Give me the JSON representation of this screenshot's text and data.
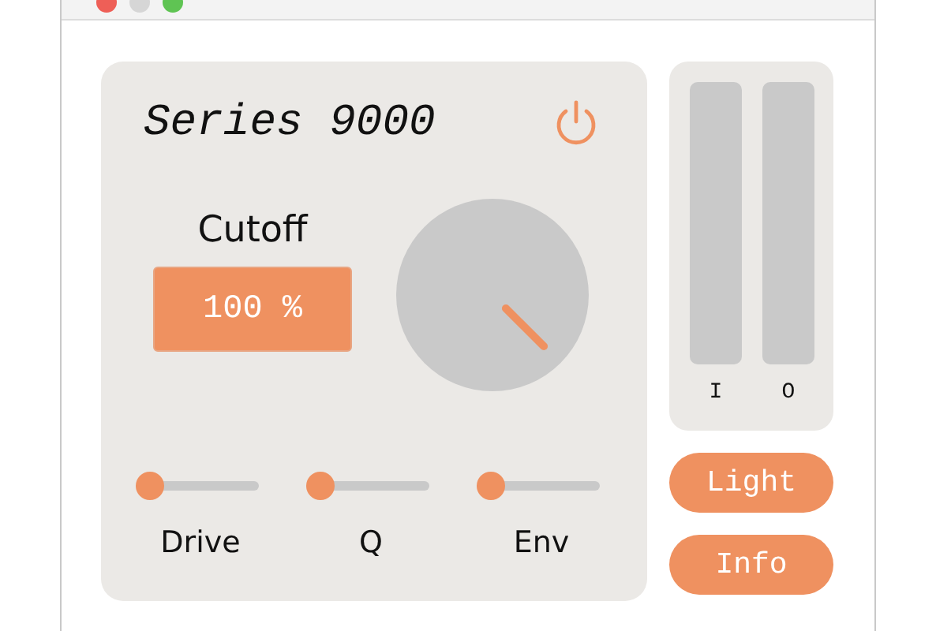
{
  "synth": {
    "title": "Series 9000",
    "power_on": true,
    "cutoff": {
      "label": "Cutoff",
      "value": "100 %"
    },
    "sliders": [
      {
        "label": "Drive",
        "level": 0
      },
      {
        "label": "Q",
        "level": 0
      },
      {
        "label": "Env",
        "level": 0
      }
    ]
  },
  "meters": [
    {
      "label": "I",
      "level": 0
    },
    {
      "label": "O",
      "level": 0
    }
  ],
  "buttons": [
    "Light",
    "Info"
  ]
}
